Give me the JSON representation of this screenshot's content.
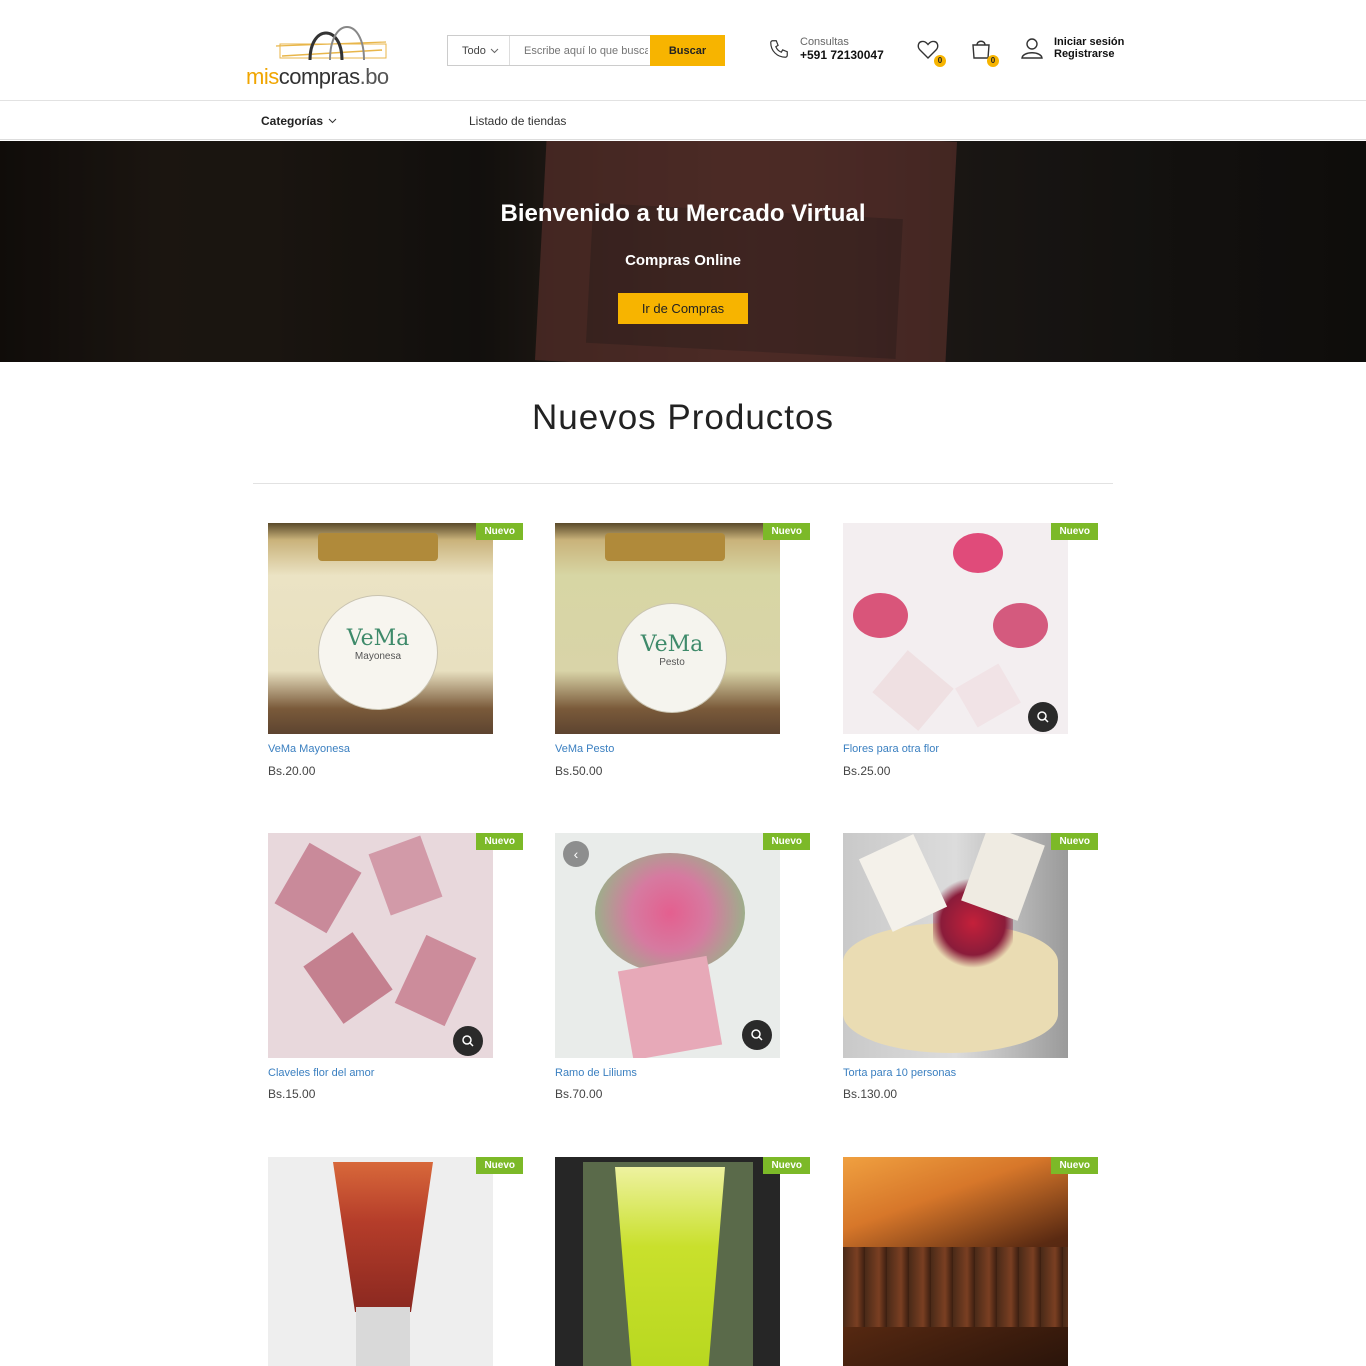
{
  "header": {
    "logo": {
      "mis": "mis",
      "compras": "compras",
      "bo": ".bo"
    },
    "search": {
      "category": "Todo",
      "placeholder": "Escribe aquí lo que buscas",
      "button": "Buscar"
    },
    "contact": {
      "label": "Consultas",
      "phone": "+591 72130047"
    },
    "wishlist_count": "0",
    "cart_count": "0",
    "account": {
      "login": "Iniciar sesión",
      "register": "Registrarse"
    },
    "colors": {
      "accent": "#f7b400",
      "badge_new": "#7cb928",
      "link": "#3a7fc0"
    }
  },
  "nav": {
    "categories": "Categorías",
    "stores": "Listado de tiendas"
  },
  "hero": {
    "title": "Bienvenido a tu Mercado Virtual",
    "subtitle": "Compras Online",
    "button": "Ir de Compras"
  },
  "section": {
    "title": "Nuevos Productos"
  },
  "products": [
    {
      "badge": "Nuevo",
      "name": "VeMa Mayonesa",
      "price": "Bs.20.00",
      "image_text": "VeMa",
      "image_sub": "Mayonesa"
    },
    {
      "badge": "Nuevo",
      "name": "VeMa Pesto",
      "price": "Bs.50.00",
      "image_text": "VeMa",
      "image_sub": "Pesto"
    },
    {
      "badge": "Nuevo",
      "name": "Flores para otra flor",
      "price": "Bs.25.00"
    },
    {
      "badge": "Nuevo",
      "name": "Claveles flor del amor",
      "price": "Bs.15.00"
    },
    {
      "badge": "Nuevo",
      "name": "Ramo de Liliums",
      "price": "Bs.70.00"
    },
    {
      "badge": "Nuevo",
      "name": "Torta para 10 personas",
      "price": "Bs.130.00"
    },
    {
      "badge": "Nuevo"
    },
    {
      "badge": "Nuevo"
    },
    {
      "badge": "Nuevo"
    }
  ]
}
